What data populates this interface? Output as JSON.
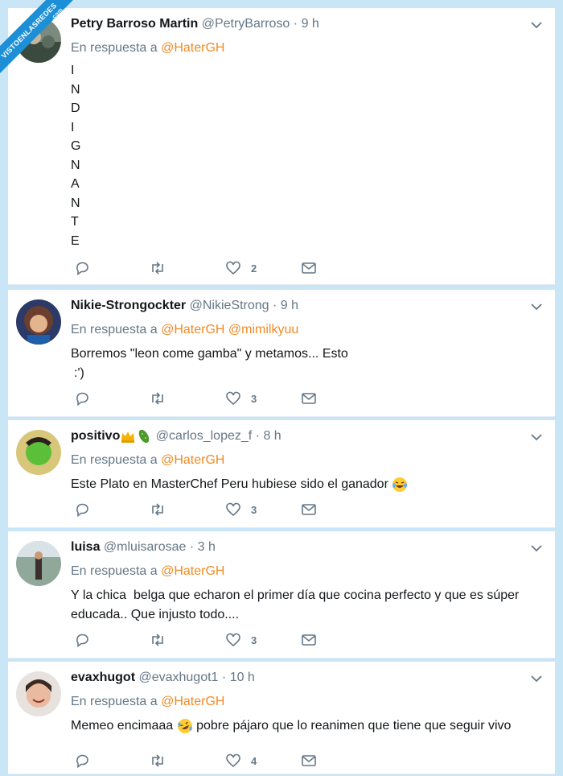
{
  "watermark": {
    "text": "VISTOENLASREDES",
    "suffix": ".com"
  },
  "colors": {
    "mention": "#f08a24",
    "muted": "#657786",
    "background": "#c9e6f7"
  },
  "tweets": [
    {
      "name": "Petry Barroso Martin",
      "handle": "@PetryBarroso",
      "time": "9 h",
      "reply_prefix": "En respuesta a",
      "mentions": [
        "@HaterGH"
      ],
      "vertical_letters": [
        "I",
        "N",
        "D",
        "I",
        "G",
        "N",
        "A",
        "N",
        "T",
        "E"
      ],
      "likes": "2"
    },
    {
      "name": "Nikie-Strongockter",
      "handle": "@NikieStrong",
      "time": "9 h",
      "reply_prefix": "En respuesta a",
      "mentions": [
        "@HaterGH",
        "@mimilkyuu"
      ],
      "text_line1": "Borremos \"leon come gamba\" y metamos... Esto",
      "text_line2": ":')",
      "likes": "3"
    },
    {
      "name": "positivo",
      "handle": "@carlos_lopez_f",
      "time": "8 h",
      "reply_prefix": "En respuesta a",
      "mentions": [
        "@HaterGH"
      ],
      "text_line1": "Este Plato en MasterChef Peru hubiese sido el ganador",
      "likes": "3"
    },
    {
      "name": "luisa",
      "handle": "@mluisarosae",
      "time": "3 h",
      "reply_prefix": "En respuesta a",
      "mentions": [
        "@HaterGH"
      ],
      "text_line1": "Y la chica  belga que echaron el primer día que cocina perfecto y que es súper",
      "text_line2": "educada.. Que injusto todo....",
      "likes": "3"
    },
    {
      "name": "evaxhugot",
      "handle": "@evaxhugot1",
      "time": "10 h",
      "reply_prefix": "En respuesta a",
      "mentions": [
        "@HaterGH"
      ],
      "text_before_emoji": "Memeo encimaaa",
      "text_after_emoji": "pobre pájaro que lo reanimen que tiene que seguir vivo",
      "likes": "4"
    }
  ]
}
